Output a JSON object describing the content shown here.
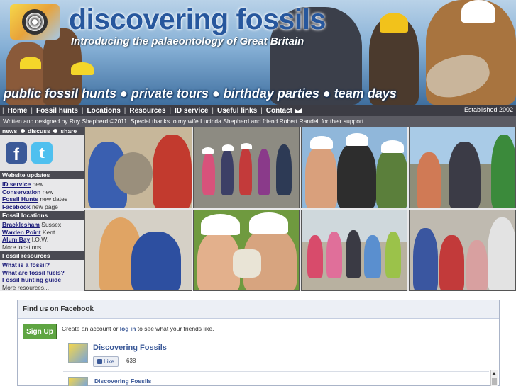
{
  "banner": {
    "title": "discovering fossils",
    "subtitle": "Introducing the palaeontology of Great Britain",
    "tagline": "public fossil hunts ● private tours ● birthday parties ● team days"
  },
  "nav": {
    "items": [
      {
        "label": "Home"
      },
      {
        "label": "Fossil hunts"
      },
      {
        "label": "Locations"
      },
      {
        "label": "Resources"
      },
      {
        "label": "ID service"
      },
      {
        "label": "Useful links"
      },
      {
        "label": "Contact"
      }
    ],
    "established": "Established 2002"
  },
  "credits": "Written and designed by Roy Shepherd ©2011. Special thanks to my wife Lucinda Shepherd and friend Robert Randell for their support.",
  "sidebar": {
    "social_head": {
      "a": "news",
      "b": "discuss",
      "c": "share"
    },
    "icons": {
      "facebook": "f",
      "twitter": "t"
    },
    "sections": [
      {
        "title": "Website updates",
        "items": [
          {
            "link": "ID service",
            "note": " new"
          },
          {
            "link": "Conservation",
            "note": " new"
          },
          {
            "link": "Fossil Hunts",
            "note": " new dates"
          },
          {
            "link": "Facebook",
            "note": " new page"
          }
        ]
      },
      {
        "title": "Fossil locations",
        "items": [
          {
            "link": "Bracklesham",
            "note": " Sussex"
          },
          {
            "link": "Warden Point",
            "note": " Kent"
          },
          {
            "link": "Alum Bay",
            "note": " I.O.W."
          }
        ],
        "more": "More locations..."
      },
      {
        "title": "Fossil resources",
        "items": [
          {
            "link": "What is a fossil?",
            "note": ""
          },
          {
            "link": "What are fossil fuels?",
            "note": ""
          },
          {
            "link": "Fossil hunting guide",
            "note": ""
          }
        ],
        "more": "More resources..."
      }
    ]
  },
  "facebook": {
    "header": "Find us on Facebook",
    "signup": "Sign Up",
    "prompt_before": "Create an account or ",
    "prompt_login": "log in",
    "prompt_after": " to see what your friends like.",
    "page_name": "Discovering Fossils",
    "like_label": "Like",
    "like_count": "638",
    "feed_name": "Discovering Fossils"
  }
}
